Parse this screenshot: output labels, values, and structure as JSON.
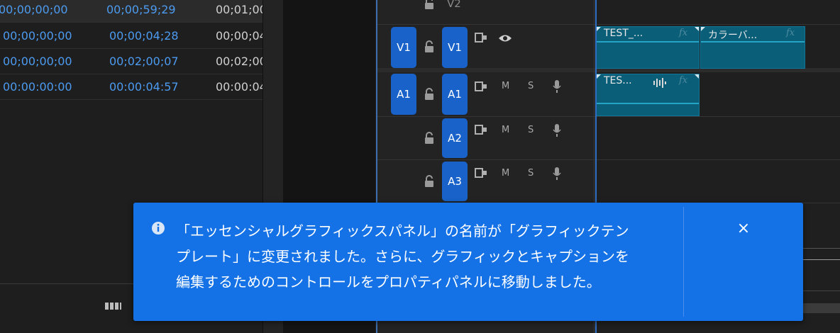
{
  "project_panel": {
    "rows": [
      {
        "start": "00;00;00;00",
        "end": "00;00;59;29",
        "duration": "00;01;00"
      },
      {
        "start": "00;00;00;00",
        "end": "00;00;04;28",
        "duration": "00;00;04"
      },
      {
        "start": "00;00;00;00",
        "end": "00;02;00;07",
        "duration": "00;02;00"
      },
      {
        "start": "00:00:00:00",
        "end": "00:00:04:57",
        "duration": "00:00:04"
      }
    ]
  },
  "timeline": {
    "tracks": {
      "v2_label": "V2",
      "v1_source": "V1",
      "v1_target": "V1",
      "a1_source": "A1",
      "a1_target": "A1",
      "a2_target": "A2",
      "a3_target": "A3",
      "mute": "M",
      "solo": "S"
    },
    "clips": {
      "v1_clip1_title": "TEST_...",
      "v1_clip2_title": "カラーバ...",
      "a1_clip1_title": "TES...",
      "fx_label": "fx"
    },
    "colors": {
      "track_button": "#1862c9",
      "clip_fill": "#0b5e78",
      "playhead": "#2f6fc6"
    }
  },
  "notification": {
    "lines": [
      "「エッセンシャルグラフィックスパネル」の名前が「グラフィックテン",
      "プレート」に変更されました。さらに、グラフィックとキャプションを",
      "編集するためのコントロールをプロパティパネルに移動しました。"
    ],
    "close_symbol": "×",
    "color": "#1472e6"
  }
}
